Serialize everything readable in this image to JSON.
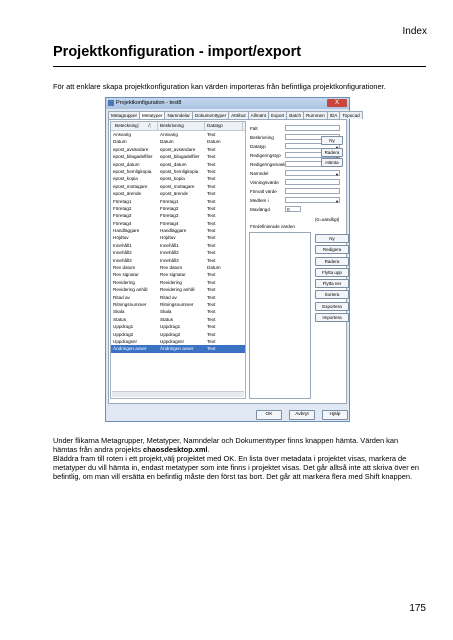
{
  "header": {
    "index_label": "Index"
  },
  "page": {
    "title": "Projektkonfiguration - import/export",
    "intro": "För att enklare skapa projektkonfiguration kan värden importeras från befintliga projektkonfigurationer.",
    "page_number": "175"
  },
  "dialog": {
    "title": "Projektkonfiguration - test8",
    "close": "X",
    "tabs": [
      "Metagrupper",
      "Metatyper",
      "Namndelar",
      "Dokumenttyper",
      "Attribut",
      "Allmänt",
      "Export",
      "Batch",
      "Rummen",
      "IDA",
      "Topocad"
    ],
    "active_tab": 1,
    "columns": [
      "Beteckning",
      "/",
      "Beskrivning",
      "Datatyp"
    ],
    "rows": [
      [
        "Ansvarig",
        "Ansvarig",
        "Text"
      ],
      [
        "Datum",
        "Datum",
        "Datum"
      ],
      [
        "epost_avsändare",
        "epost_avsändare",
        "Text"
      ],
      [
        "epost_bilagadelfiler",
        "epost_bilagadelfiler",
        "Text"
      ],
      [
        "epost_datum",
        "epost_datum",
        "Text"
      ],
      [
        "epost_hemligkopia",
        "epost_hemligkopia",
        "Text"
      ],
      [
        "epost_kopia",
        "epost_kopia",
        "Text"
      ],
      [
        "epost_mottagare",
        "epost_mottagare",
        "Text"
      ],
      [
        "epost_ärende",
        "epost_ärende",
        "Text"
      ],
      [
        "Företag1",
        "Företag1",
        "Text"
      ],
      [
        "Företag2",
        "Företag2",
        "Text"
      ],
      [
        "Företag3",
        "Företag3",
        "Text"
      ],
      [
        "Företag4",
        "Företag4",
        "Text"
      ],
      [
        "Handläggare",
        "Handläggare",
        "Text"
      ],
      [
        "Höjdtuv",
        "Höjdtuv",
        "Text"
      ],
      [
        "Innehåll1",
        "Innehåll1",
        "Text"
      ],
      [
        "Innehåll2",
        "Innehåll2",
        "Text"
      ],
      [
        "Innehåll3",
        "Innehåll3",
        "Text"
      ],
      [
        "Rev datum",
        "Rev datum",
        "Datum"
      ],
      [
        "Rev signatur",
        "Rev signatur",
        "Text"
      ],
      [
        "Revidering",
        "Revidering",
        "Text"
      ],
      [
        "Revidering anhål",
        "Revidering anhål",
        "Text"
      ],
      [
        "Ritad av",
        "Ritad av",
        "Text"
      ],
      [
        "Ritningsnummer",
        "Ritningsnummer",
        "Text"
      ],
      [
        "Skala",
        "Skala",
        "Text"
      ],
      [
        "Status",
        "Status",
        "Text"
      ],
      [
        "Uppdrag1",
        "Uppdrag1",
        "Text"
      ],
      [
        "Uppdrag2",
        "Uppdrag2",
        "Text"
      ],
      [
        "Uppdragsnr",
        "Uppdragsnr",
        "Text"
      ],
      [
        "Ändringen avser",
        "Ändringen avser",
        "Text"
      ]
    ],
    "selected_row": 29,
    "fields": [
      {
        "label": "Fält",
        "value": "",
        "dropdown": false
      },
      {
        "label": "Beskrivning",
        "value": "",
        "dropdown": false
      },
      {
        "label": "Datatyp",
        "value": "",
        "dropdown": true
      },
      {
        "label": "Redigeringstyp",
        "value": "",
        "dropdown": true
      },
      {
        "label": "Redigeringsmask",
        "value": "",
        "dropdown": false
      },
      {
        "label": "Namndel",
        "value": "",
        "dropdown": true
      },
      {
        "label": "Visningsvärde",
        "value": "",
        "dropdown": false
      },
      {
        "label": "Förvalt värde",
        "value": "",
        "dropdown": false
      },
      {
        "label": "Medlem i",
        "value": "",
        "dropdown": true
      },
      {
        "label": "Maxlängd",
        "value": "0",
        "dropdown": false
      }
    ],
    "maxlength_hint": "(0=oändligt)",
    "predefined_label": "Fördefinierade värden",
    "side_buttons": [
      "Ny",
      "Redigera",
      "Radera",
      "Flytta upp",
      "Flytta ner",
      "Sortera",
      "Exportera",
      "Importera"
    ],
    "right_buttons": [
      "Ny",
      "Radera",
      "Hämta"
    ],
    "bottom_buttons": [
      "OK",
      "Avbryt",
      "Hjälp"
    ]
  },
  "body_text": {
    "p1": "Under flikarna Metagrupper, Metatyper, Namndelar och Dokumenttyper finns knappen hämta. Värden kan hämtas från andra projekts chaosdesktop.xml.",
    "p1a": "Under flikarna Metagrupper, Metatyper, Namndelar och Dokumenttyper finns knappen hämta. Värden kan hämtas från andra projekts ",
    "p1b": "chaosdesktop.xml",
    "p1c": ".",
    "p2": "Bläddra fram till roten i ett projekt,välj projektet med OK. En lista över metadata i projektet visas, markera de metatyper du vill hämta in, endast metatyper som inte finns i projektet visas. Det går alltså inte att skriva över en befintlig, om man vill ersätta en befintlig måste den först tas bort. Det går att markera flera med Shift knappen."
  }
}
